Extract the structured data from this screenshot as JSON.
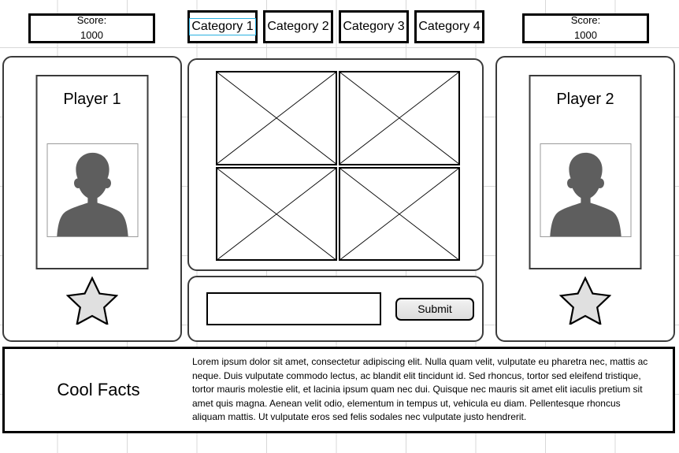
{
  "scores": {
    "left": {
      "label": "Score:",
      "value": "1000"
    },
    "right": {
      "label": "Score:",
      "value": "1000"
    }
  },
  "categories": {
    "selected_index": 0,
    "tabs": [
      {
        "label": "Category 1"
      },
      {
        "label": "Category 2"
      },
      {
        "label": "Category 3"
      },
      {
        "label": "Category 4"
      }
    ]
  },
  "players": [
    {
      "name": "Player 1",
      "avatar_icon": "person-silhouette-icon",
      "badge_icon": "star-icon"
    },
    {
      "name": "Player 2",
      "avatar_icon": "person-silhouette-icon",
      "badge_icon": "star-icon"
    }
  ],
  "image_grid": {
    "placeholders": [
      {
        "alt": "image-placeholder-1"
      },
      {
        "alt": "image-placeholder-2"
      },
      {
        "alt": "image-placeholder-3"
      },
      {
        "alt": "image-placeholder-4"
      }
    ]
  },
  "answer_bar": {
    "input_value": "",
    "input_placeholder": "",
    "submit_label": "Submit"
  },
  "facts": {
    "title": "Cool Facts",
    "body": "Lorem ipsum dolor sit amet, consectetur adipiscing elit. Nulla quam velit, vulputate eu pharetra nec, mattis ac neque. Duis vulputate commodo lectus, ac blandit elit tincidunt id. Sed rhoncus, tortor sed eleifend tristique, tortor mauris molestie elit, et lacinia ipsum quam nec dui. Quisque nec mauris sit amet elit iaculis pretium sit amet quis magna. Aenean velit odio, elementum in tempus ut, vehicula eu diam. Pellentesque rhoncus aliquam mattis. Ut vulputate eros sed felis sodales nec vulputate justo hendrerit."
  },
  "colors": {
    "selection_outline": "#29b0e0",
    "panel_border": "#3b3b3b",
    "hard_border": "#000000",
    "avatar_fill": "#5e5e5e",
    "star_fill": "#e0e0e0",
    "grid_line": "#d8d8d8"
  }
}
